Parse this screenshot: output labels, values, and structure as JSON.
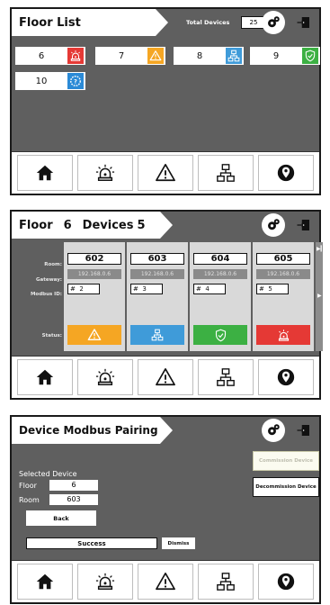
{
  "screen1": {
    "title": "Floor List",
    "total_devices_label": "Total Devices",
    "total_devices_value": "25",
    "floors": [
      {
        "number": "6",
        "status_icon": "alarm-icon",
        "color": "#e53935"
      },
      {
        "number": "7",
        "status_icon": "warning-icon",
        "color": "#f5a623"
      },
      {
        "number": "8",
        "status_icon": "network-icon",
        "color": "#3f9bd9"
      },
      {
        "number": "9",
        "status_icon": "shield-check-icon",
        "color": "#3cb043"
      },
      {
        "number": "10",
        "status_icon": "question-gear-icon",
        "color": "#2b8ad6"
      }
    ]
  },
  "screen2": {
    "title_floor_label": "Floor",
    "title_floor_value": "6",
    "title_devices_label": "Devices",
    "title_devices_value": "5",
    "row_labels": {
      "room": "Room:",
      "gateway": "Gateway:",
      "modbus": "Modbus ID:",
      "status": "Status:"
    },
    "devices": [
      {
        "room": "602",
        "gateway": "192.168.0.6",
        "modbus_prefix": "#",
        "modbus": "2",
        "status_icon": "warning-icon",
        "color": "#f5a623"
      },
      {
        "room": "603",
        "gateway": "192.168.0.6",
        "modbus_prefix": "#",
        "modbus": "3",
        "status_icon": "network-icon",
        "color": "#3f9bd9"
      },
      {
        "room": "604",
        "gateway": "192.168.0.6",
        "modbus_prefix": "#",
        "modbus": "4",
        "status_icon": "shield-check-icon",
        "color": "#3cb043"
      },
      {
        "room": "605",
        "gateway": "192.168.0.6",
        "modbus_prefix": "#",
        "modbus": "5",
        "status_icon": "alarm-icon",
        "color": "#e53935"
      }
    ]
  },
  "screen3": {
    "title": "Device Modbus Pairing",
    "commission_label": "Commission Device",
    "decommission_label": "Decommission Device",
    "selected_device_label": "Selected Device",
    "floor_label": "Floor",
    "floor_value": "6",
    "room_label": "Room",
    "room_value": "603",
    "back_label": "Back",
    "result_text": "Success",
    "dismiss_label": "Dismiss"
  },
  "nav_icons": [
    "home-icon",
    "alarm-icon",
    "warning-icon",
    "network-icon",
    "location-icon"
  ]
}
